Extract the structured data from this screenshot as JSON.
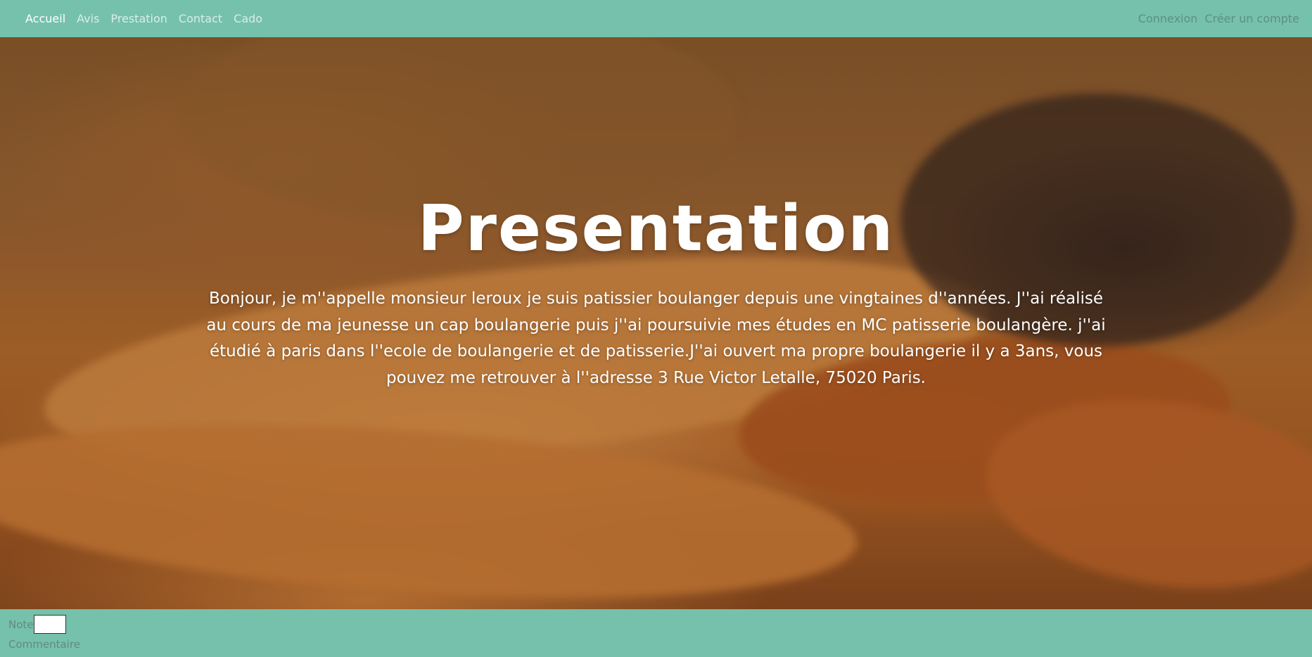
{
  "navbar": {
    "left_links": [
      {
        "label": "Accueil",
        "active": true
      },
      {
        "label": "Avis",
        "active": false
      },
      {
        "label": "Prestation",
        "active": false
      },
      {
        "label": "Contact",
        "active": false
      },
      {
        "label": "Cado",
        "active": false
      }
    ],
    "right_links": [
      {
        "label": "Connexion"
      },
      {
        "label": "Créer un compte"
      }
    ],
    "background_color": "#76c1ab"
  },
  "hero": {
    "title": "Presentation",
    "text": "Bonjour, je m''appelle monsieur leroux je suis patissier boulanger depuis une vingtaines d''années. J''ai réalisé au cours de ma jeunesse un cap boulangerie puis j''ai poursuivie mes études en MC patisserie boulangère. j''ai étudié à paris dans l''ecole de boulangerie et de patisserie.J''ai ouvert ma propre boulangerie il y a 3ans, vous pouvez me retrouver à l''adresse 3 Rue Victor Letalle, 75020 Paris.",
    "background_image": "baguettes-photo"
  },
  "footer": {
    "note_label": "Note",
    "note_value": "",
    "comment_label": "Commentaire"
  }
}
